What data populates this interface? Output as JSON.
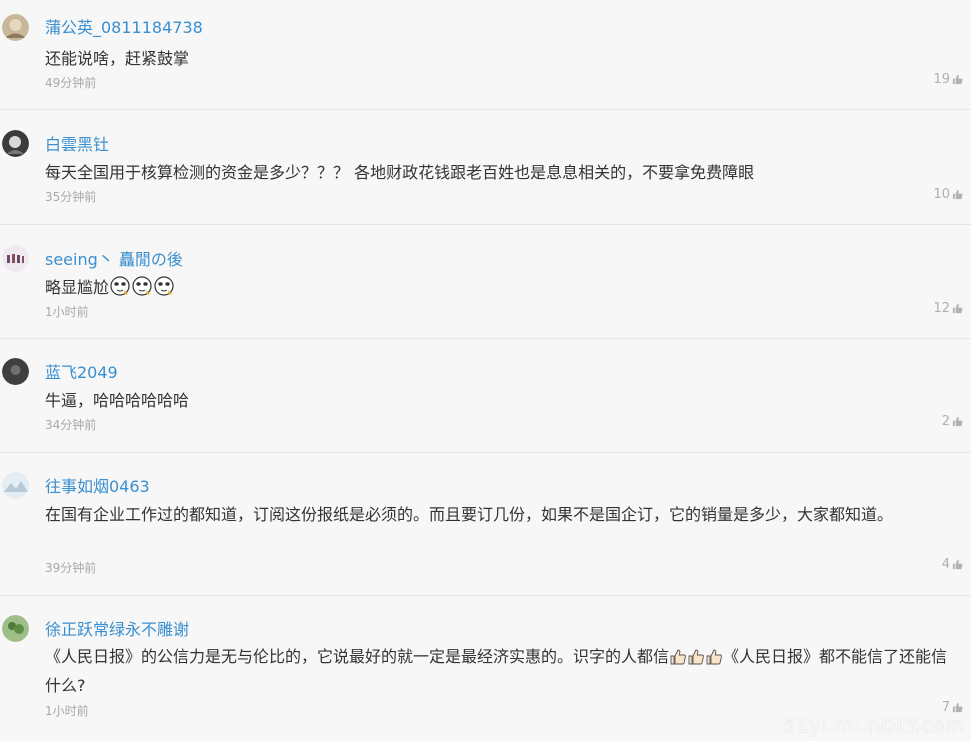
{
  "comments": [
    {
      "username": "蒲公英_0811184738",
      "content": "还能说啥，赶紧鼓掌",
      "time": "49分钟前",
      "likes": "19"
    },
    {
      "username": "白雲黑钍",
      "content": "每天全国用于核算检测的资金是多少？？？ 各地财政花钱跟老百姓也是息息相关的，不要拿免费障眼",
      "time": "35分钟前",
      "likes": "10"
    },
    {
      "username": "seeing丶 矗閒の後",
      "content": "略显尴尬",
      "time": "1小时前",
      "likes": "12"
    },
    {
      "username": "蓝飞2049",
      "content": "牛逼，哈哈哈哈哈哈",
      "time": "34分钟前",
      "likes": "2"
    },
    {
      "username": "往事如烟0463",
      "content": "在国有企业工作过的都知道，订阅这份报纸是必须的。而且要订几份，如果不是国企订，它的销量是多少，大家都知道。",
      "time": "39分钟前",
      "likes": "4"
    },
    {
      "username": "徐正跃常绿永不雕谢",
      "content_part1": "《人民日报》的公信力是无与伦比的，它说最好的就一定是最经济实惠的。识字的人都信",
      "content_part2": "《人民日报》都不能信了还能信什么?",
      "time": "1小时前",
      "likes": "7"
    }
  ],
  "watermark": "51yi.mi.nDLY.com",
  "colors": {
    "username": "#3a8fd0",
    "text": "#333333",
    "meta": "#a9a9a9",
    "background": "#f7f7f7"
  }
}
